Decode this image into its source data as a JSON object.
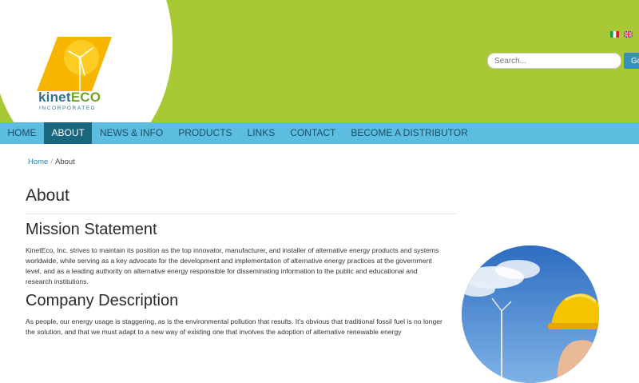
{
  "logo": {
    "name_part1": "kinet",
    "name_part2": "ECO",
    "tagline": "INCORPORATED"
  },
  "header": {
    "languages": [
      {
        "name": "Italiano",
        "icon": "italy-flag-icon"
      },
      {
        "name": "English",
        "icon": "uk-flag-icon"
      }
    ],
    "search": {
      "placeholder": "Search...",
      "button_label": "Go!"
    }
  },
  "nav": {
    "items": [
      {
        "label": "HOME"
      },
      {
        "label": "ABOUT",
        "active": true
      },
      {
        "label": "NEWS & INFO"
      },
      {
        "label": "PRODUCTS"
      },
      {
        "label": "LINKS"
      },
      {
        "label": "CONTACT"
      },
      {
        "label": "BECOME A DISTRIBUTOR"
      }
    ]
  },
  "breadcrumb": {
    "home": "Home",
    "separator": "/",
    "current": "About"
  },
  "main": {
    "title": "About",
    "mission_heading": "Mission Statement",
    "mission_text": "KinetEco, Inc. strives to maintain its position as the top innovator, manufacturer, and installer of alternative energy products and systems worldwide, while serving as a key advocate for the development and implementation of alternative energy practices at the government level, and as a leading authority on alternative energy responsible for disseminating information to the public and educational and research institutions.",
    "company_heading": "Company Description",
    "company_text": "As people, our energy usage is staggering, as is the environmental pollution that results. It's obvious that traditional fossil fuel is no longer the solution, and that we must adapt to a new way of existing one that involves the adoption of alternative renewable energy"
  },
  "colors": {
    "header_green": "#a9c835",
    "nav_blue": "#5bbde0",
    "nav_active": "#18677f",
    "button_blue": "#3592b9",
    "logo_blue": "#2d6f92",
    "logo_green": "#6ea52b"
  }
}
